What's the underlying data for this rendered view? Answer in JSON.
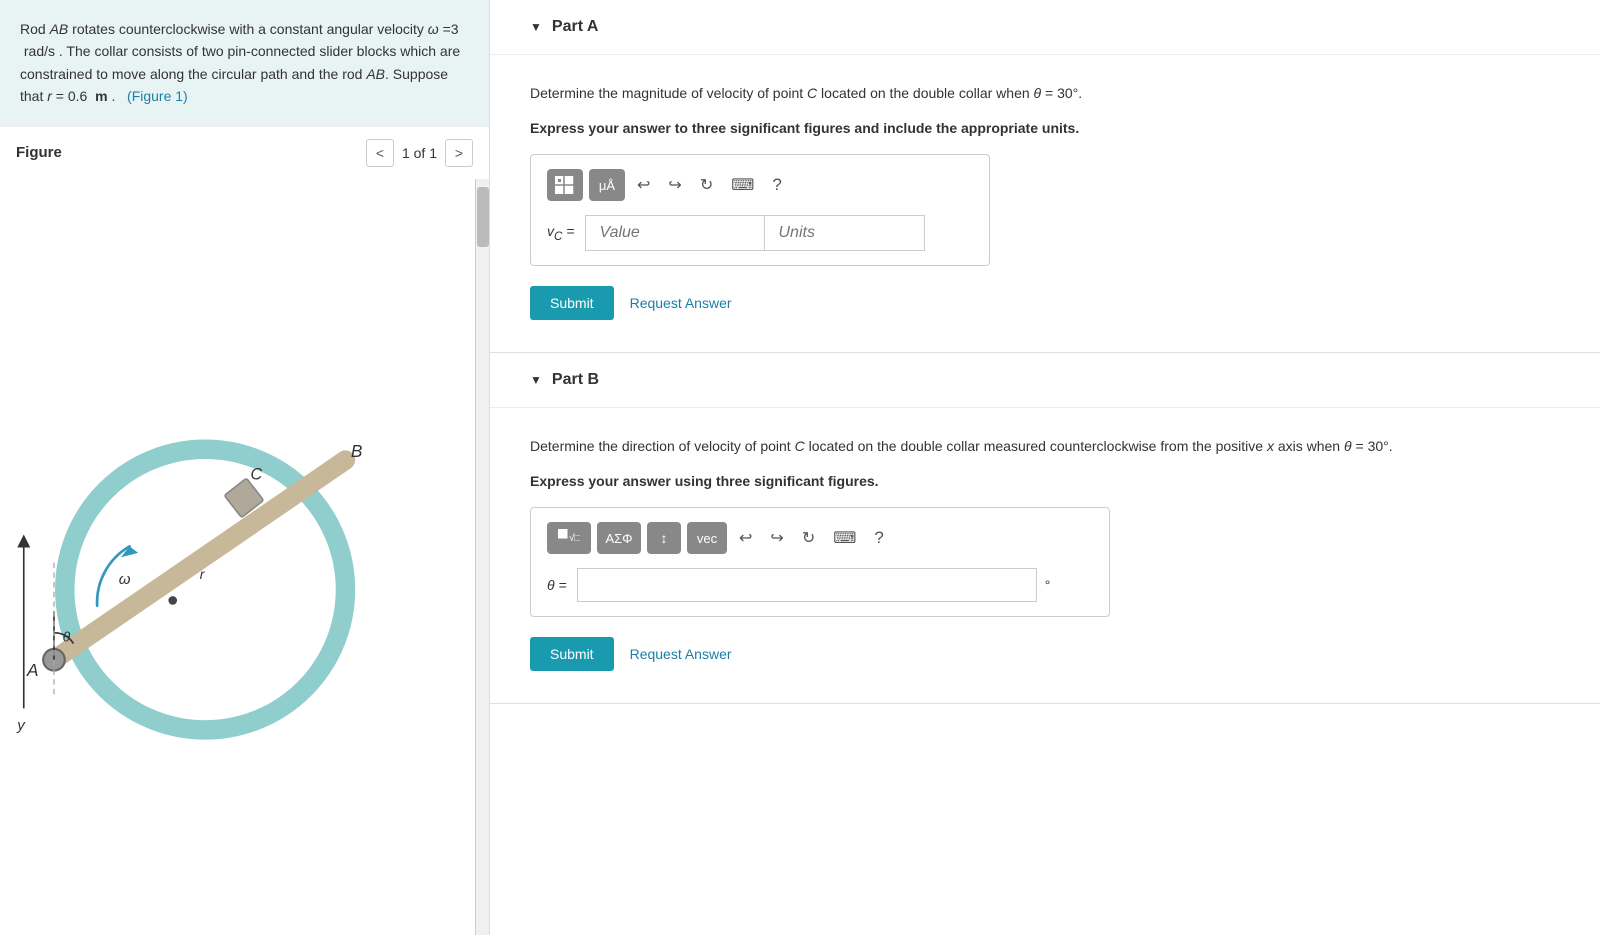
{
  "left": {
    "problem": {
      "text_parts": [
        "Rod AB rotates counterclockwise with a constant angular velocity ω = 3  rad/s . The collar consists of two pin-connected slider blocks which are constrained to move along the circular path and the rod AB. Suppose that r = 0.6  m .",
        "(Figure 1)"
      ]
    },
    "figure": {
      "title": "Figure",
      "nav_prev": "<",
      "nav_next": ">",
      "page": "1 of 1"
    }
  },
  "right": {
    "partA": {
      "label": "Part A",
      "question": "Determine the magnitude of velocity of point C located on the double collar when θ = 30°.",
      "instruction": "Express your answer to three significant figures and include the appropriate units.",
      "toolbar": {
        "btn1": "⊞",
        "btn2": "μÅ",
        "undo": "↩",
        "redo": "↪",
        "refresh": "↻",
        "keyboard": "⌨",
        "help": "?"
      },
      "input_label": "vC =",
      "value_placeholder": "Value",
      "units_placeholder": "Units",
      "submit_label": "Submit",
      "request_label": "Request Answer"
    },
    "partB": {
      "label": "Part B",
      "question": "Determine the direction of velocity of point C located on the double collar measured counterclockwise from the positive x axis when θ = 30°.",
      "instruction": "Express your answer using three significant figures.",
      "toolbar": {
        "btn1": "⊞√□",
        "btn2": "ΑΣΦ",
        "btn3": "↕",
        "btn4": "vec",
        "undo": "↩",
        "redo": "↪",
        "refresh": "↻",
        "keyboard": "⌨",
        "help": "?"
      },
      "input_label": "θ =",
      "degree_symbol": "°",
      "submit_label": "Submit",
      "request_label": "Request Answer"
    }
  }
}
